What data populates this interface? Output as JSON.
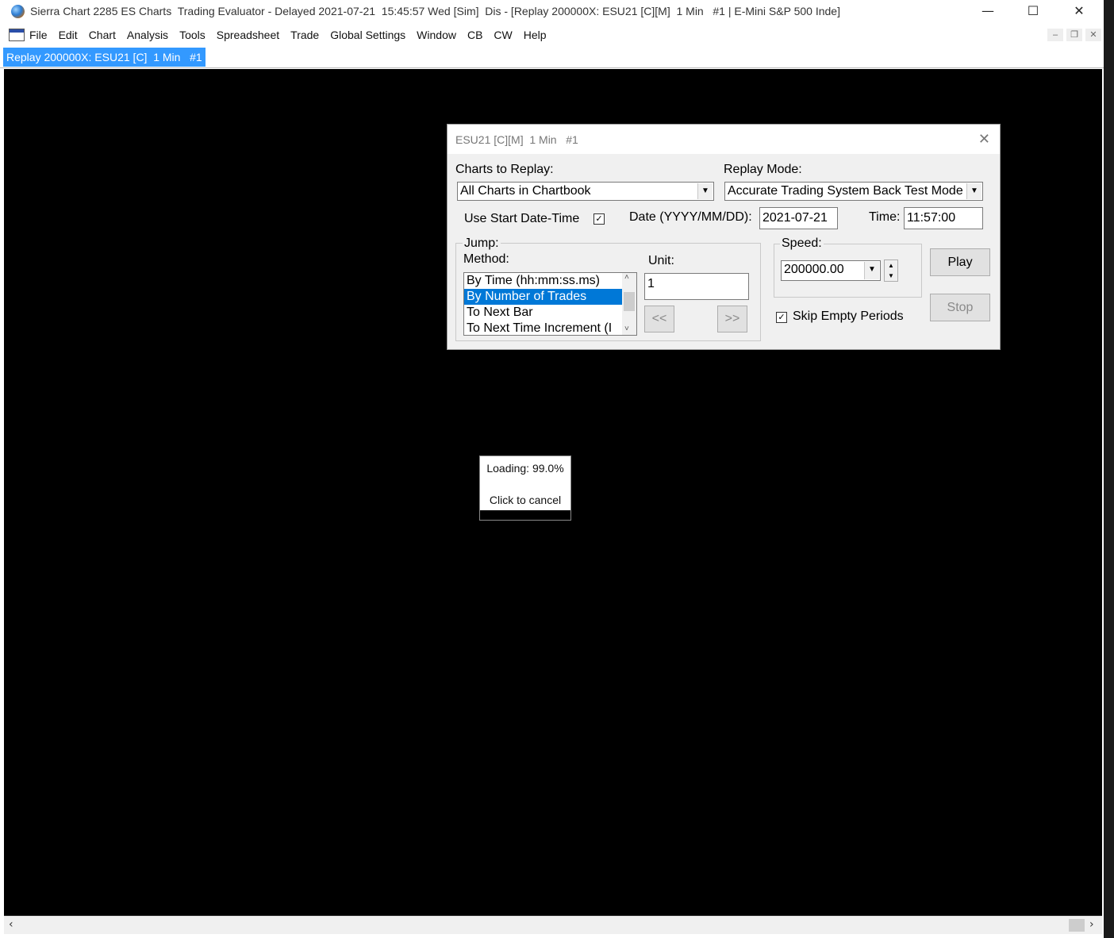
{
  "window": {
    "title": "Sierra Chart 2285 ES Charts  Trading Evaluator - Delayed 2021-07-21  15:45:57 Wed [Sim]  Dis - [Replay 200000X: ESU21 [C][M]  1 Min   #1 | E-Mini S&P 500 Inde]",
    "minimize": "—",
    "maximize": "☐",
    "close": "✕"
  },
  "menu": {
    "items": [
      "File",
      "Edit",
      "Chart",
      "Analysis",
      "Tools",
      "Spreadsheet",
      "Trade",
      "Global Settings",
      "Window",
      "CB",
      "CW",
      "Help"
    ],
    "mdi_min": "‒",
    "mdi_restore": "❐",
    "mdi_close": "✕"
  },
  "tab": {
    "label": "Replay 200000X: ESU21 [C]  1 Min   #1"
  },
  "dialog": {
    "title": "ESU21 [C][M]  1 Min   #1",
    "charts_to_replay_label": "Charts to Replay:",
    "charts_to_replay_value": "All Charts in Chartbook",
    "replay_mode_label": "Replay Mode:",
    "replay_mode_value": "Accurate Trading System Back Test Mode",
    "use_start_label": "Use Start Date-Time",
    "use_start_checked": true,
    "date_label": "Date (YYYY/MM/DD):",
    "date_value": "2021-07-21",
    "time_label": "Time:",
    "time_value": "11:57:00",
    "jump_label": "Jump:",
    "method_label": "Method:",
    "method_items": [
      "By Time (hh:mm:ss.ms)",
      "By Number of Trades",
      "To Next Bar",
      "To Next Time Increment (I"
    ],
    "method_selected_index": 1,
    "unit_label": "Unit:",
    "unit_value": "1",
    "back_button": "<<",
    "forward_button": ">>",
    "speed_label": "Speed:",
    "speed_value": "200000.00",
    "play_button": "Play",
    "stop_button": "Stop",
    "skip_empty_label": "Skip Empty Periods",
    "skip_empty_checked": true
  },
  "loading": {
    "text": "Loading: 99.0%",
    "cancel": "Click to cancel",
    "progress": 0.99
  },
  "colors": {
    "chart_background": "#000000",
    "selection": "#0078d7",
    "tab_active": "#3399ff"
  }
}
